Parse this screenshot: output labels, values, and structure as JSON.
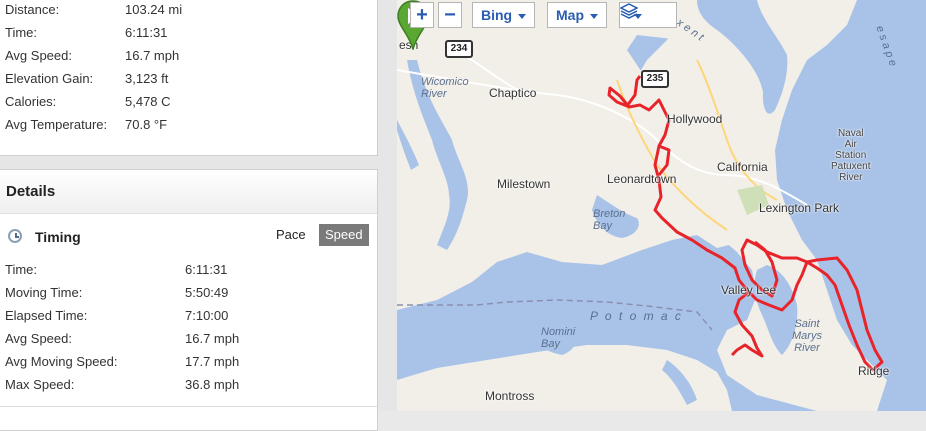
{
  "summary": {
    "rows": [
      {
        "label": "Distance:",
        "value": "103.24 mi"
      },
      {
        "label": "Time:",
        "value": "6:11:31"
      },
      {
        "label": "Avg Speed:",
        "value": "16.7 mph"
      },
      {
        "label": "Elevation Gain:",
        "value": "3,123 ft"
      },
      {
        "label": "Calories:",
        "value": "5,478 C"
      },
      {
        "label": "Avg Temperature:",
        "value": "70.8 °F"
      }
    ]
  },
  "details": {
    "title": "Details",
    "timing_title": "Timing",
    "pace_label": "Pace",
    "speed_label": "Speed",
    "rows": [
      {
        "label": "Time:",
        "value": "6:11:31"
      },
      {
        "label": "Moving Time:",
        "value": "5:50:49"
      },
      {
        "label": "Elapsed Time:",
        "value": "7:10:00"
      },
      {
        "label": "Avg Speed:",
        "value": "16.7 mph"
      },
      {
        "label": "Avg Moving Speed:",
        "value": "17.7 mph"
      },
      {
        "label": "Max Speed:",
        "value": "36.8 mph"
      }
    ]
  },
  "map": {
    "zoom_in": "+",
    "zoom_out": "−",
    "provider": "Bing",
    "type": "Map",
    "labels": {
      "hollywood": "Hollywood",
      "chaptico": "Chaptico",
      "california": "California",
      "milestown": "Milestown",
      "leonardtown": "Leonardtown",
      "lexington_park": "Lexington Park",
      "valley_lee": "Valley Lee",
      "ridge": "Ridge",
      "montross": "Montross",
      "esh": "esh",
      "wicomico_river": "Wicomico\nRiver",
      "breton_bay": "Breton\nBay",
      "nomini_bay": "Nomini\nBay",
      "potomac": "P o t o m a c",
      "st_marys_river": "Saint\nMarys\nRiver",
      "naval_air_station": "Naval\nAir\nStation\nPatuxent\nRiver",
      "patuxent": "x e n t",
      "chesapeake": "e s a p e"
    },
    "routes": {
      "r234": "234",
      "r235": "235"
    },
    "colors": {
      "track": "#e8232a",
      "water": "#a9c3e8",
      "land": "#f2efe9",
      "pin": "#5aa832"
    }
  }
}
